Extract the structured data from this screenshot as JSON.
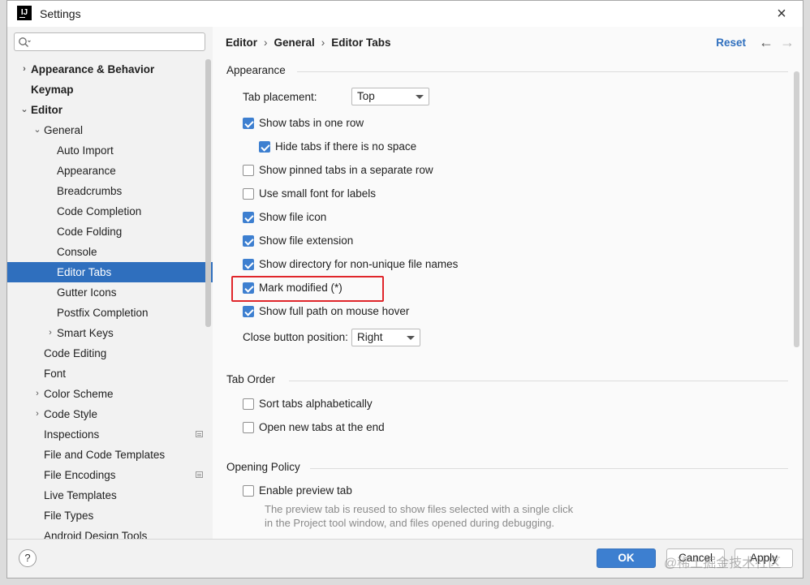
{
  "window": {
    "title": "Settings",
    "logo_text": "IJ",
    "close_glyph": "×"
  },
  "sidebar": {
    "search": {
      "placeholder": "",
      "value": ""
    },
    "items": [
      {
        "label": "Appearance & Behavior",
        "arrow": "›",
        "bold": true
      },
      {
        "label": "Keymap",
        "bold": true
      },
      {
        "label": "Editor",
        "arrow": "⌄",
        "bold": true
      },
      {
        "label": "General",
        "arrow": "⌄"
      },
      {
        "label": "Auto Import"
      },
      {
        "label": "Appearance"
      },
      {
        "label": "Breadcrumbs"
      },
      {
        "label": "Code Completion"
      },
      {
        "label": "Code Folding"
      },
      {
        "label": "Console"
      },
      {
        "label": "Editor Tabs",
        "selected": true
      },
      {
        "label": "Gutter Icons"
      },
      {
        "label": "Postfix Completion"
      },
      {
        "label": "Smart Keys",
        "arrow": "›"
      },
      {
        "label": "Code Editing"
      },
      {
        "label": "Font"
      },
      {
        "label": "Color Scheme",
        "arrow": "›"
      },
      {
        "label": "Code Style",
        "arrow": "›"
      },
      {
        "label": "Inspections",
        "side_icon": true
      },
      {
        "label": "File and Code Templates"
      },
      {
        "label": "File Encodings",
        "side_icon": true
      },
      {
        "label": "Live Templates"
      },
      {
        "label": "File Types"
      },
      {
        "label": "Android Design Tools"
      }
    ]
  },
  "header": {
    "breadcrumb": [
      "Editor",
      "General",
      "Editor Tabs"
    ],
    "separator": "›",
    "reset": "Reset",
    "back_glyph": "←",
    "forward_glyph": "→"
  },
  "appearance": {
    "title": "Appearance",
    "tab_placement_label": "Tab placement:",
    "tab_placement_value": "Top",
    "show_tabs_one_row": {
      "label": "Show tabs in one row",
      "checked": true
    },
    "hide_tabs_no_space": {
      "label": "Hide tabs if there is no space",
      "checked": true
    },
    "show_pinned_separate": {
      "label": "Show pinned tabs in a separate row",
      "checked": false
    },
    "small_font": {
      "label": "Use small font for labels",
      "checked": false
    },
    "show_file_icon": {
      "label": "Show file icon",
      "checked": true
    },
    "show_file_extension": {
      "label": "Show file extension",
      "checked": true
    },
    "show_directory": {
      "label": "Show directory for non-unique file names",
      "checked": true
    },
    "mark_modified": {
      "label": "Mark modified (*)",
      "checked": true
    },
    "show_full_path": {
      "label": "Show full path on mouse hover",
      "checked": true
    },
    "close_button_label": "Close button position:",
    "close_button_value": "Right"
  },
  "tab_order": {
    "title": "Tab Order",
    "sort_alpha": {
      "label": "Sort tabs alphabetically",
      "checked": false
    },
    "open_at_end": {
      "label": "Open new tabs at the end",
      "checked": false
    }
  },
  "opening_policy": {
    "title": "Opening Policy",
    "enable_preview": {
      "label": "Enable preview tab",
      "checked": false
    },
    "note_line1": "The preview tab is reused to show files selected with a single click",
    "note_line2": "in the Project tool window, and files opened during debugging."
  },
  "footer": {
    "help": "?",
    "ok": "OK",
    "cancel": "Cancel",
    "apply": "Apply"
  },
  "watermark": "@稀土掘金技术社区",
  "colors": {
    "accent": "#3d7fd0",
    "selection": "#2f6fbe",
    "highlight_box": "#e0262b"
  }
}
